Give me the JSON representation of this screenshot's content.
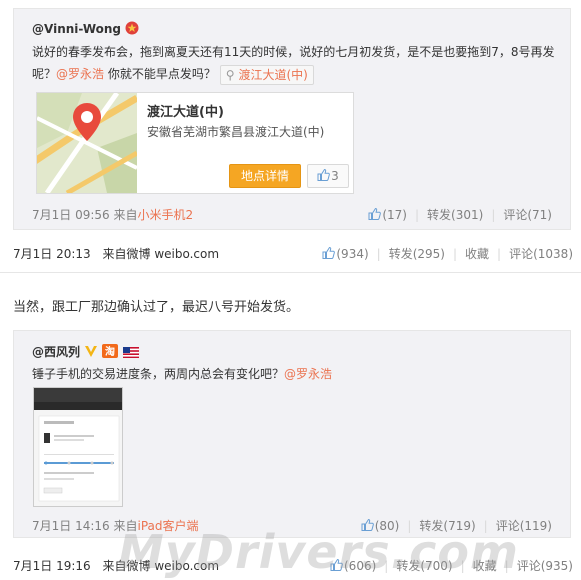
{
  "post1": {
    "quoted": {
      "user": "@Vinni-Wong",
      "text_a": "说好的春季发布会，拖到离夏天还有11天的时候，说好的七月初发货，是不是也要拖到7，8号再发呢？",
      "mention": "@罗永浩",
      "text_b": " 你就不能早点发吗？",
      "location_chip": "渡江大道(中)",
      "place": {
        "title": "渡江大道(中)",
        "address": "安徽省芜湖市繁昌县渡江大道(中)",
        "detail_button": "地点详情",
        "like_count": "3"
      },
      "time": "7月1日 09:56",
      "source_prefix": "来自",
      "source": "小米手机2",
      "likes": "(17)",
      "repost": "转发(301)",
      "comment": "评论(71)"
    },
    "time": "7月1日 20:13",
    "source_prefix": "来自",
    "source": "微博 weibo.com",
    "likes": "(934)",
    "repost": "转发(295)",
    "favorite": "收藏",
    "comment": "评论(1038)"
  },
  "post2": {
    "text": "当然，跟工厂那边确认过了，最迟八号开始发货。",
    "quoted": {
      "user": "@西风列",
      "text": "锤子手机的交易进度条，两周内总会有变化吧？",
      "mention": "@罗永浩",
      "time": "7月1日 14:16",
      "source_prefix": "来自",
      "source": "iPad客户端",
      "likes": "(80)",
      "repost": "转发(719)",
      "comment": "评论(119)"
    },
    "time": "7月1日 19:16",
    "source_prefix": "来自",
    "source": "微博 weibo.com",
    "likes": "(606)",
    "repost": "转发(700)",
    "favorite": "收藏",
    "comment": "评论(935)"
  },
  "watermark": "MyDrivers.com",
  "colors": {
    "accent": "#eb7350",
    "box_bg": "#f2f2f5",
    "button_orange": "#f5a623",
    "muted": "#808080"
  }
}
